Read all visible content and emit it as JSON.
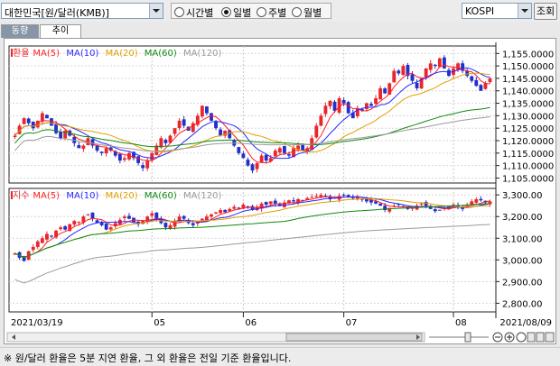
{
  "toolbar": {
    "market_select": "대한민국[원/달러(KMB)]",
    "period_options": [
      {
        "label": "시간별",
        "selected": false
      },
      {
        "label": "일별",
        "selected": true
      },
      {
        "label": "주별",
        "selected": false
      },
      {
        "label": "월별",
        "selected": false
      }
    ],
    "index_select": "KOSPI",
    "lookup_button": "조회"
  },
  "tabs": [
    {
      "label": "동향",
      "active": false
    },
    {
      "label": "추이",
      "active": true
    }
  ],
  "footer_note": "※ 원/달러 환율은 5분 지연 환율, 그 외 환율은 전일 기준 환율입니다.",
  "colors": {
    "up": "#e8272d",
    "down": "#2230c8",
    "ma5": "#ff2020",
    "ma10": "#2828ff",
    "ma20": "#e0a000",
    "ma60": "#108a10",
    "ma120": "#9a9a9a"
  },
  "chart_data": [
    {
      "type": "candlestick",
      "legend": [
        "환율",
        "MA(5)",
        "MA(10)",
        "MA(20)",
        "MA(60)",
        "MA(120)"
      ],
      "yticks": [
        "1,155.0000",
        "1,150.0000",
        "1,145.0000",
        "1,140.0000",
        "1,135.0000",
        "1,130.0000",
        "1,125.0000",
        "1,120.0000",
        "1,115.0000",
        "1,110.0000",
        "1,105.0000"
      ],
      "ylim": [
        1103,
        1158
      ],
      "closes": [
        1122,
        1126,
        1129,
        1127,
        1125,
        1128,
        1131,
        1129,
        1126,
        1123,
        1121,
        1124,
        1122,
        1119,
        1117,
        1118,
        1121,
        1118,
        1116,
        1115,
        1117,
        1116,
        1114,
        1112,
        1113,
        1115,
        1113,
        1111,
        1109,
        1112,
        1115,
        1118,
        1121,
        1119,
        1122,
        1125,
        1128,
        1126,
        1124,
        1127,
        1130,
        1134,
        1131,
        1128,
        1125,
        1122,
        1124,
        1121,
        1118,
        1115,
        1113,
        1110,
        1108,
        1111,
        1114,
        1112,
        1113,
        1116,
        1117,
        1115,
        1114,
        1117,
        1118,
        1116,
        1117,
        1121,
        1126,
        1130,
        1134,
        1136,
        1132,
        1137,
        1135,
        1131,
        1129,
        1133,
        1132,
        1135,
        1134,
        1137,
        1141,
        1139,
        1143,
        1148,
        1147,
        1150,
        1146,
        1144,
        1141,
        1145,
        1149,
        1151,
        1150,
        1153,
        1149,
        1146,
        1149,
        1151,
        1148,
        1146,
        1144,
        1142,
        1140,
        1143,
        1145
      ]
    },
    {
      "type": "candlestick",
      "legend": [
        "지수",
        "MA(5)",
        "MA(10)",
        "MA(20)",
        "MA(60)",
        "MA(120)"
      ],
      "yticks": [
        "3,300.00",
        "3,200.00",
        "3,100.00",
        "3,000.00",
        "2,900.00",
        "2,800.00"
      ],
      "ylim": [
        2760,
        3330
      ],
      "closes": [
        3030,
        3010,
        2995,
        3040,
        3060,
        3085,
        3100,
        3120,
        3110,
        3135,
        3150,
        3140,
        3165,
        3180,
        3175,
        3200,
        3210,
        3190,
        3170,
        3160,
        3140,
        3150,
        3170,
        3185,
        3200,
        3190,
        3175,
        3165,
        3180,
        3200,
        3215,
        3190,
        3170,
        3150,
        3160,
        3180,
        3200,
        3190,
        3170,
        3160,
        3175,
        3190,
        3200,
        3210,
        3220,
        3230,
        3220,
        3235,
        3245,
        3240,
        3255,
        3240,
        3230,
        3245,
        3260,
        3255,
        3270,
        3260,
        3250,
        3265,
        3275,
        3270,
        3280,
        3275,
        3285,
        3290,
        3295,
        3300,
        3290,
        3280,
        3285,
        3295,
        3300,
        3290,
        3285,
        3290,
        3280,
        3270,
        3265,
        3260,
        3250,
        3230,
        3240,
        3250,
        3255,
        3245,
        3235,
        3240,
        3250,
        3260,
        3250,
        3235,
        3225,
        3230,
        3240,
        3250,
        3255,
        3245,
        3235,
        3250,
        3270,
        3280,
        3275,
        3265,
        3270
      ]
    }
  ],
  "xaxis": {
    "labels": [
      "2021/03/19",
      "05",
      "06",
      "07",
      "08",
      "2021/08/09"
    ]
  }
}
